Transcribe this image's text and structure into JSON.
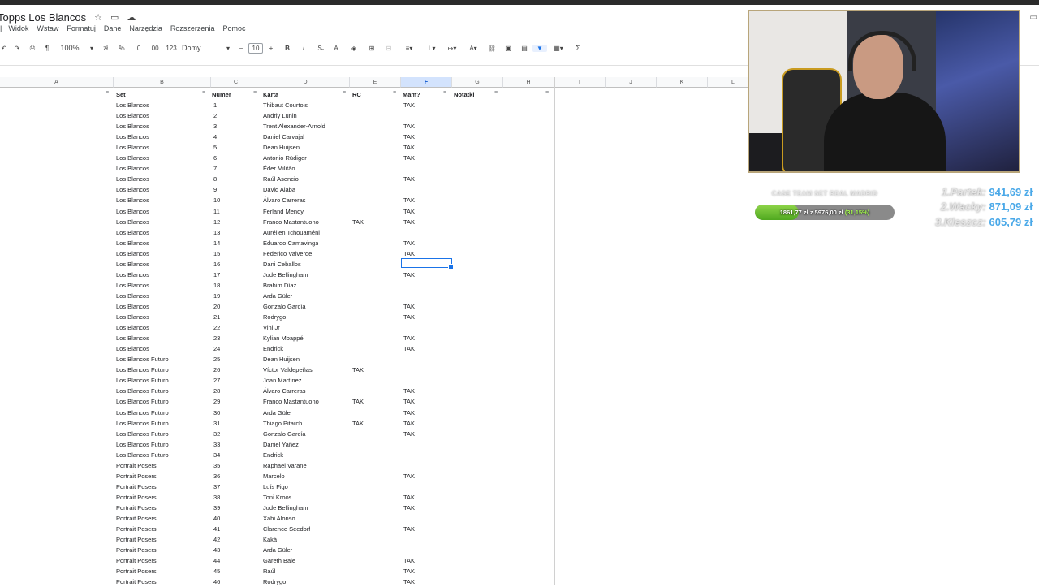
{
  "doc": {
    "title": "Topps Los Blancos",
    "star_icon": "star-icon",
    "folder_icon": "folder-icon",
    "cloud_icon": "cloud-icon"
  },
  "menu": {
    "items": [
      "Widok",
      "Wstaw",
      "Formatuj",
      "Dane",
      "Narzędzia",
      "Rozszerzenia",
      "Pomoc"
    ]
  },
  "toolbar": {
    "zoom": "100%",
    "font": "Domy...",
    "font_size": "10",
    "format_percent": "%",
    "format_123": "123",
    "bold": "B",
    "italic": "I",
    "sum": "Σ"
  },
  "columns": [
    "A",
    "B",
    "C",
    "D",
    "E",
    "F",
    "G",
    "H",
    "I",
    "J",
    "K",
    "L"
  ],
  "header": {
    "set": "Set",
    "numer": "Numer",
    "karta": "Karta",
    "rc": "RC",
    "mam": "Mam?",
    "notatki": "Notatki"
  },
  "rows": [
    {
      "set": "Los Blancos",
      "num": "1",
      "karta": "Thibaut Courtois",
      "rc": "",
      "mam": "TAK"
    },
    {
      "set": "Los Blancos",
      "num": "2",
      "karta": "Andriy Lunin",
      "rc": "",
      "mam": ""
    },
    {
      "set": "Los Blancos",
      "num": "3",
      "karta": "Trent Alexander-Arnold",
      "rc": "",
      "mam": "TAK"
    },
    {
      "set": "Los Blancos",
      "num": "4",
      "karta": "Daniel Carvajal",
      "rc": "",
      "mam": "TAK"
    },
    {
      "set": "Los Blancos",
      "num": "5",
      "karta": "Dean Huijsen",
      "rc": "",
      "mam": "TAK"
    },
    {
      "set": "Los Blancos",
      "num": "6",
      "karta": "Antonio Rüdiger",
      "rc": "",
      "mam": "TAK"
    },
    {
      "set": "Los Blancos",
      "num": "7",
      "karta": "Éder Militão",
      "rc": "",
      "mam": ""
    },
    {
      "set": "Los Blancos",
      "num": "8",
      "karta": "Raúl Asencio",
      "rc": "",
      "mam": "TAK"
    },
    {
      "set": "Los Blancos",
      "num": "9",
      "karta": "David Alaba",
      "rc": "",
      "mam": ""
    },
    {
      "set": "Los Blancos",
      "num": "10",
      "karta": "Álvaro Carreras",
      "rc": "",
      "mam": "TAK"
    },
    {
      "set": "Los Blancos",
      "num": "11",
      "karta": "Ferland Mendy",
      "rc": "",
      "mam": "TAK"
    },
    {
      "set": "Los Blancos",
      "num": "12",
      "karta": "Franco Mastantuono",
      "rc": "TAK",
      "mam": "TAK"
    },
    {
      "set": "Los Blancos",
      "num": "13",
      "karta": "Aurélien Tchouaméni",
      "rc": "",
      "mam": ""
    },
    {
      "set": "Los Blancos",
      "num": "14",
      "karta": "Eduardo Camavinga",
      "rc": "",
      "mam": "TAK"
    },
    {
      "set": "Los Blancos",
      "num": "15",
      "karta": "Federico Valverde",
      "rc": "",
      "mam": "TAK"
    },
    {
      "set": "Los Blancos",
      "num": "16",
      "karta": "Dani Ceballos",
      "rc": "",
      "mam": ""
    },
    {
      "set": "Los Blancos",
      "num": "17",
      "karta": "Jude Bellingham",
      "rc": "",
      "mam": "TAK"
    },
    {
      "set": "Los Blancos",
      "num": "18",
      "karta": "Brahim Díaz",
      "rc": "",
      "mam": ""
    },
    {
      "set": "Los Blancos",
      "num": "19",
      "karta": "Arda Güler",
      "rc": "",
      "mam": ""
    },
    {
      "set": "Los Blancos",
      "num": "20",
      "karta": "Gonzalo García",
      "rc": "",
      "mam": "TAK"
    },
    {
      "set": "Los Blancos",
      "num": "21",
      "karta": "Rodrygo",
      "rc": "",
      "mam": "TAK"
    },
    {
      "set": "Los Blancos",
      "num": "22",
      "karta": "Vini Jr",
      "rc": "",
      "mam": ""
    },
    {
      "set": "Los Blancos",
      "num": "23",
      "karta": "Kylian Mbappé",
      "rc": "",
      "mam": "TAK"
    },
    {
      "set": "Los Blancos",
      "num": "24",
      "karta": "Endrick",
      "rc": "",
      "mam": "TAK"
    },
    {
      "set": "Los Blancos Futuro",
      "num": "25",
      "karta": "Dean Huijsen",
      "rc": "",
      "mam": ""
    },
    {
      "set": "Los Blancos Futuro",
      "num": "26",
      "karta": "Víctor Valdepeñas",
      "rc": "TAK",
      "mam": ""
    },
    {
      "set": "Los Blancos Futuro",
      "num": "27",
      "karta": "Joan Martínez",
      "rc": "",
      "mam": ""
    },
    {
      "set": "Los Blancos Futuro",
      "num": "28",
      "karta": "Álvaro Carreras",
      "rc": "",
      "mam": "TAK"
    },
    {
      "set": "Los Blancos Futuro",
      "num": "29",
      "karta": "Franco Mastantuono",
      "rc": "TAK",
      "mam": "TAK"
    },
    {
      "set": "Los Blancos Futuro",
      "num": "30",
      "karta": "Arda Güler",
      "rc": "",
      "mam": "TAK"
    },
    {
      "set": "Los Blancos Futuro",
      "num": "31",
      "karta": "Thiago Pitarch",
      "rc": "TAK",
      "mam": "TAK"
    },
    {
      "set": "Los Blancos Futuro",
      "num": "32",
      "karta": "Gonzalo García",
      "rc": "",
      "mam": "TAK"
    },
    {
      "set": "Los Blancos Futuro",
      "num": "33",
      "karta": "Daniel Yañez",
      "rc": "",
      "mam": ""
    },
    {
      "set": "Los Blancos Futuro",
      "num": "34",
      "karta": "Endrick",
      "rc": "",
      "mam": ""
    },
    {
      "set": "Portrait Posers",
      "num": "35",
      "karta": "Raphaël Varane",
      "rc": "",
      "mam": ""
    },
    {
      "set": "Portrait Posers",
      "num": "36",
      "karta": "Marcelo",
      "rc": "",
      "mam": "TAK"
    },
    {
      "set": "Portrait Posers",
      "num": "37",
      "karta": "Luís Figo",
      "rc": "",
      "mam": ""
    },
    {
      "set": "Portrait Posers",
      "num": "38",
      "karta": "Toni Kroos",
      "rc": "",
      "mam": "TAK"
    },
    {
      "set": "Portrait Posers",
      "num": "39",
      "karta": "Jude Bellingham",
      "rc": "",
      "mam": "TAK"
    },
    {
      "set": "Portrait Posers",
      "num": "40",
      "karta": "Xabi Alonso",
      "rc": "",
      "mam": ""
    },
    {
      "set": "Portrait Posers",
      "num": "41",
      "karta": "Clarence Seedorf",
      "rc": "",
      "mam": "TAK"
    },
    {
      "set": "Portrait Posers",
      "num": "42",
      "karta": "Kaká",
      "rc": "",
      "mam": ""
    },
    {
      "set": "Portrait Posers",
      "num": "43",
      "karta": "Arda Güler",
      "rc": "",
      "mam": ""
    },
    {
      "set": "Portrait Posers",
      "num": "44",
      "karta": "Gareth Bale",
      "rc": "",
      "mam": "TAK"
    },
    {
      "set": "Portrait Posers",
      "num": "45",
      "karta": "Raúl",
      "rc": "",
      "mam": "TAK"
    },
    {
      "set": "Portrait Posers",
      "num": "46",
      "karta": "Rodrygo",
      "rc": "",
      "mam": "TAK"
    }
  ],
  "overlay": {
    "goal_label": "CASE TEAM SET REAL MADRID",
    "progress_text": "1861,77 zł z 5976,00 zł",
    "progress_pct": "(31,15%)",
    "progress_fraction": 0.3115,
    "ranking": [
      {
        "name": "1.Partek:",
        "value": "941,69 zł"
      },
      {
        "name": "2.Wacky:",
        "value": "871,09 zł"
      },
      {
        "name": "3.Kleszcz:",
        "value": "605,79 zł"
      }
    ]
  },
  "colors": {
    "accent": "#1a73e8",
    "progress_green": "#6cc23a",
    "rank_blue": "#49a8e8"
  }
}
